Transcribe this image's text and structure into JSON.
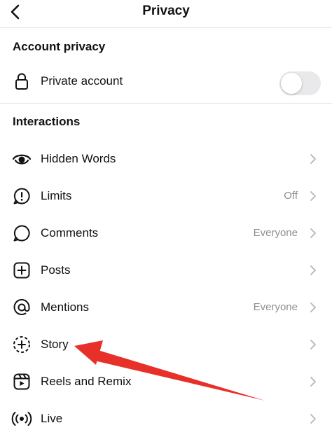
{
  "header": {
    "title": "Privacy",
    "back_icon": "chevron-left-icon"
  },
  "account_privacy": {
    "section_title": "Account privacy",
    "private_account": {
      "label": "Private account",
      "icon": "lock-icon",
      "enabled": false
    }
  },
  "interactions": {
    "section_title": "Interactions",
    "items": [
      {
        "label": "Hidden Words",
        "icon": "eye-icon",
        "value": ""
      },
      {
        "label": "Limits",
        "icon": "limits-icon",
        "value": "Off"
      },
      {
        "label": "Comments",
        "icon": "comment-icon",
        "value": "Everyone"
      },
      {
        "label": "Posts",
        "icon": "plus-square-icon",
        "value": ""
      },
      {
        "label": "Mentions",
        "icon": "at-sign-icon",
        "value": "Everyone"
      },
      {
        "label": "Story",
        "icon": "story-add-icon",
        "value": ""
      },
      {
        "label": "Reels and Remix",
        "icon": "reels-icon",
        "value": ""
      },
      {
        "label": "Live",
        "icon": "live-icon",
        "value": ""
      }
    ]
  },
  "colors": {
    "annotation_arrow": "#e8302a",
    "secondary_text": "#8e8e8e",
    "divider": "#e6e6e6",
    "toggle_off": "#e9e9eb"
  }
}
